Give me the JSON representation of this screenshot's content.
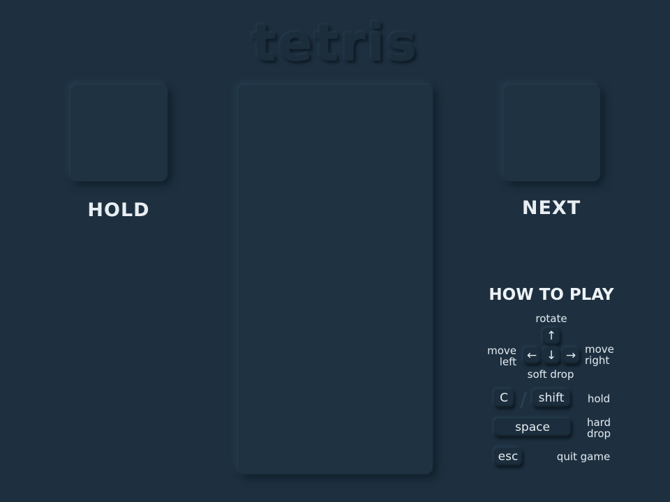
{
  "title": "tetris",
  "hold": {
    "label": "HOLD"
  },
  "next": {
    "label": "NEXT"
  },
  "how_to_play": {
    "title": "HOW TO PLAY",
    "rotate": "rotate",
    "soft_drop": "soft drop",
    "move_left_1": "move",
    "move_left_2": "left",
    "move_right_1": "move",
    "move_right_2": "right",
    "keys": {
      "up": "↑",
      "left": "←",
      "down": "↓",
      "right": "→",
      "c": "C",
      "shift": "shift",
      "space": "space",
      "esc": "esc"
    },
    "hold_action": "hold",
    "hard_drop_1": "hard",
    "hard_drop_2": "drop",
    "quit": "quit game"
  },
  "colors": {
    "background": "#1e3040",
    "panel": "#1f3242",
    "text": "#e8eef2"
  }
}
